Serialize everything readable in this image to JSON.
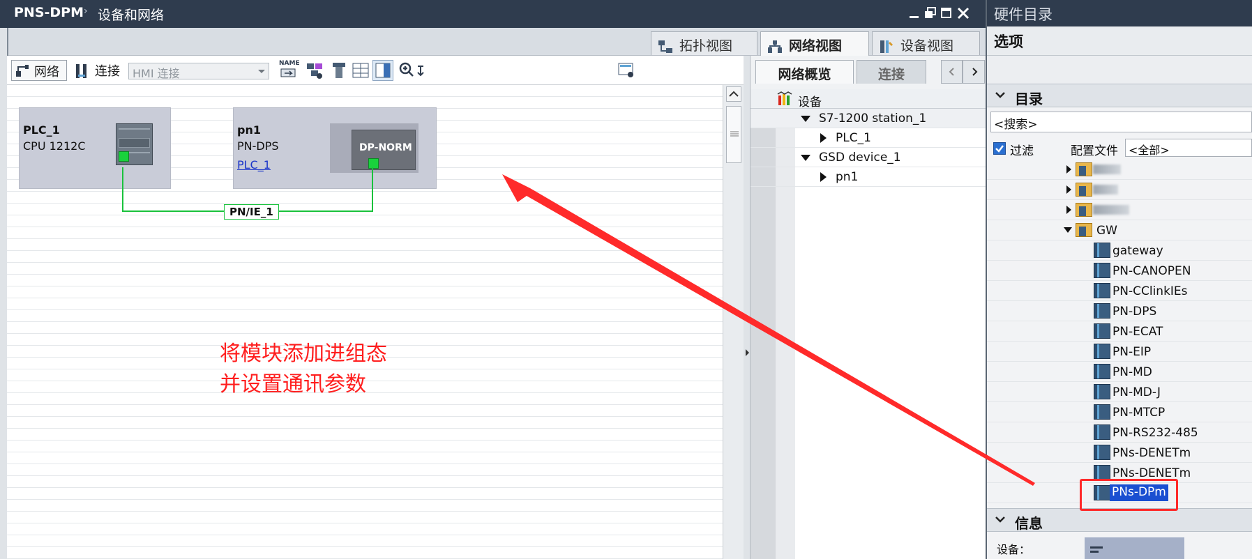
{
  "titlebar": {
    "project": "PNS-DPM",
    "separator": "›",
    "breadcrumb": "设备和网络"
  },
  "view_tabs": [
    "拓扑视图",
    "网络视图",
    "设备视图"
  ],
  "toolbar": {
    "network_label": "网络",
    "connect_label": "连接",
    "connection_type": "HMI 连接",
    "name_label": "NAME"
  },
  "devices": [
    {
      "name": "PLC_1",
      "type": "CPU 1212C"
    },
    {
      "name": "pn1",
      "type": "PN-DPS",
      "link": "PLC_1",
      "module_label": "DP-NORM"
    }
  ],
  "network_label": "PN/IE_1",
  "annotation": {
    "line1": "将模块添加进组态",
    "line2": "并设置通讯参数"
  },
  "overview": {
    "tabs": [
      "网络概览",
      "连接"
    ],
    "column_header": "设备",
    "rows": [
      {
        "label": "S7-1200 station_1",
        "expanded": true
      },
      {
        "label": "PLC_1",
        "expanded": false
      },
      {
        "label": "GSD device_1",
        "expanded": true
      },
      {
        "label": "pn1",
        "expanded": false
      }
    ]
  },
  "catalog": {
    "title": "硬件目录",
    "options_label": "选项",
    "section_catalog": "目录",
    "search_placeholder": "<搜索>",
    "filter_label": "过滤",
    "profile_label": "配置文件",
    "profile_value": "<全部>",
    "folder_gw": "GW",
    "items": [
      "gateway",
      "PN-CANOPEN",
      "PN-CClinkIEs",
      "PN-DPS",
      "PN-ECAT",
      "PN-EIP",
      "PN-MD",
      "PN-MD-J",
      "PN-MTCP",
      "PN-RS232-485",
      "PNs-DENETm",
      "PNs-DENETm",
      "PNs-DPm"
    ],
    "section_info": "信息",
    "info_device_label": "设备："
  },
  "colors": {
    "titlebar": "#2f3c4e",
    "green": "#19d23c",
    "annotation_red": "#ff1e1e",
    "selection": "#1a4fd1"
  }
}
